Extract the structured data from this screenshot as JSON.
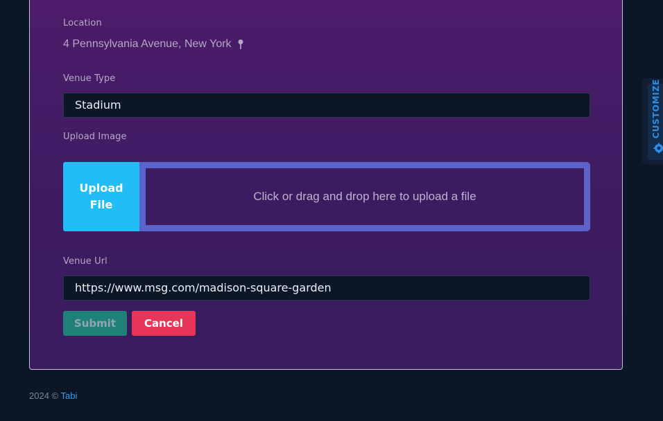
{
  "form": {
    "location_label": "Location",
    "location_value": "4 Pennsylvania Avenue, New York",
    "venue_type_label": "Venue Type",
    "venue_type_value": "Stadium",
    "upload_label": "Upload Image",
    "upload_button": "Upload File",
    "dropzone_text": "Click or drag and drop here to upload a file",
    "venue_url_label": "Venue Url",
    "venue_url_value": "https://www.msg.com/madison-square-garden",
    "submit_label": "Submit",
    "cancel_label": "Cancel"
  },
  "footer": {
    "copyright": "2024 ©",
    "brand": "Tabi"
  },
  "customize_panel": {
    "label": "CUSTOMIZE",
    "icon": "gear-icon"
  },
  "colors": {
    "upload_button": "#22bdf6",
    "dropzone_border": "#5c64cc",
    "submit": "#1f8075",
    "cancel": "#e8355a",
    "link": "#3b9ef5"
  }
}
